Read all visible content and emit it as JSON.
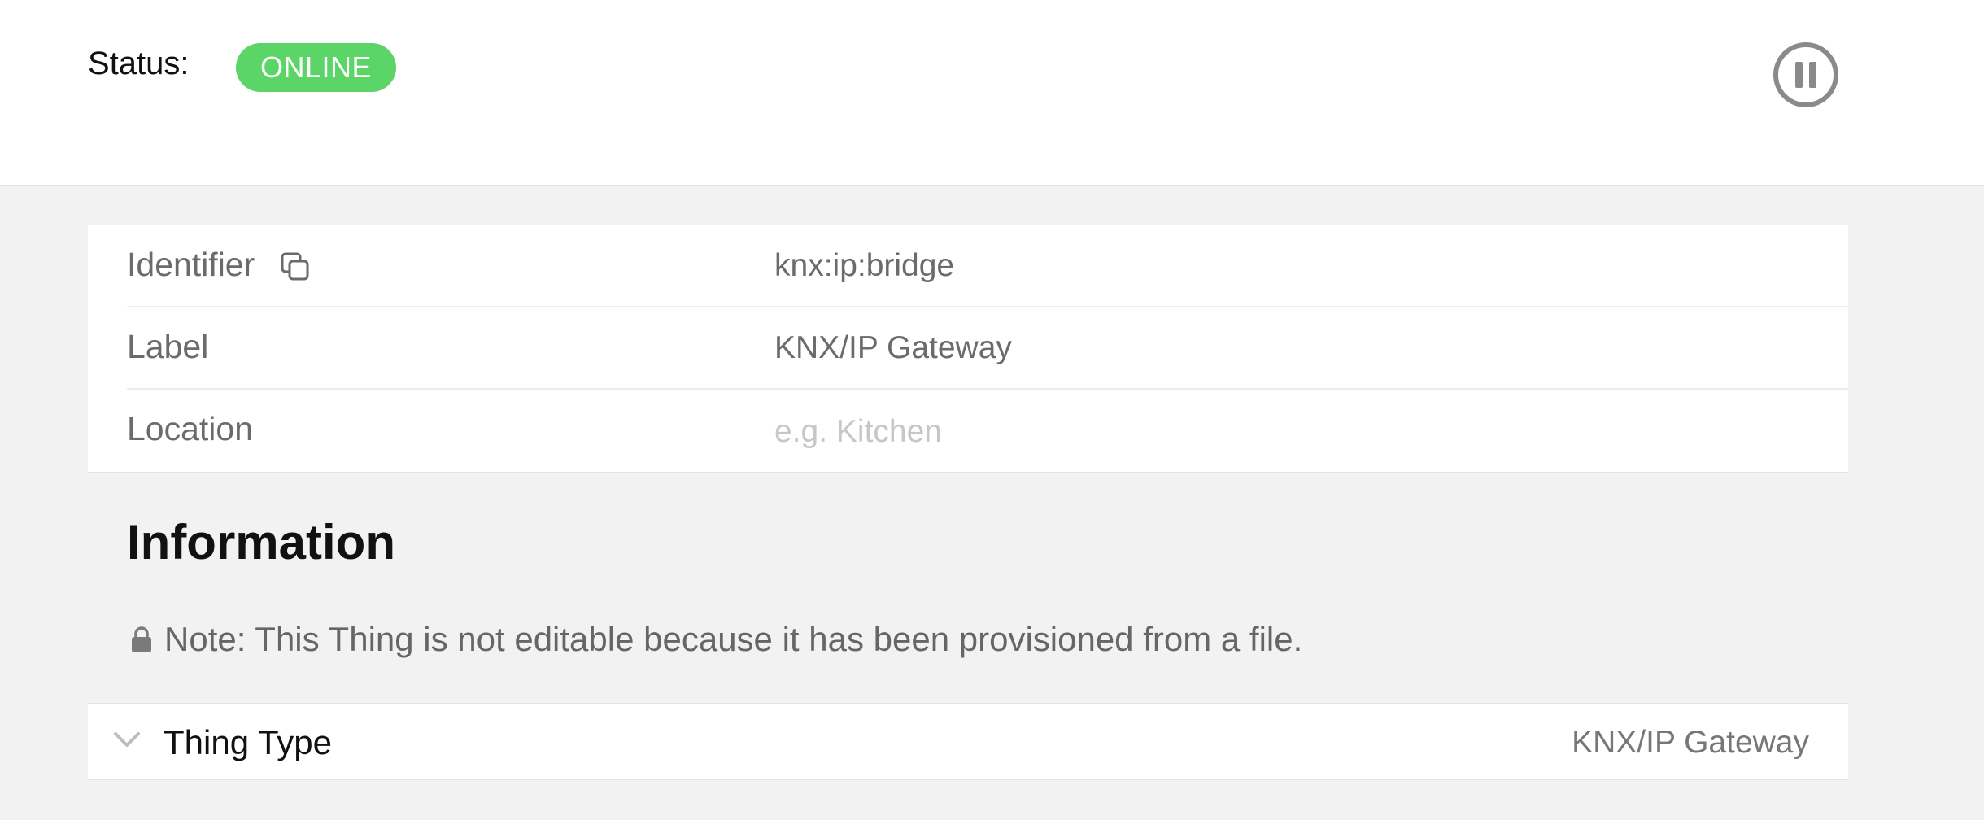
{
  "header": {
    "status_label": "Status:",
    "status_value": "ONLINE",
    "status_color": "#5bd567",
    "pause_icon": "pause-circle-icon"
  },
  "properties": {
    "identifier": {
      "name": "Identifier",
      "value": "knx:ip:bridge",
      "icon": "copy-icon"
    },
    "label": {
      "name": "Label",
      "value": "KNX/IP Gateway"
    },
    "location": {
      "name": "Location",
      "value": "",
      "placeholder": "e.g. Kitchen"
    }
  },
  "information": {
    "title": "Information",
    "note_icon": "lock-icon",
    "note": "Note: This Thing is not editable because it has been provisioned from a file.",
    "thing_type": {
      "icon": "chevron-down-icon",
      "title": "Thing Type",
      "value": "KNX/IP Gateway"
    }
  }
}
